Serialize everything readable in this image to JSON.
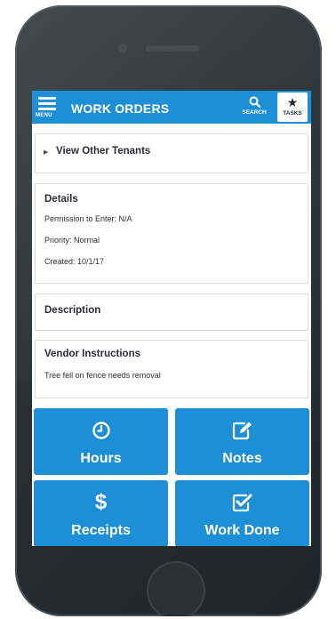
{
  "header": {
    "menu_label": "MENU",
    "title": "WORK ORDERS",
    "search_label": "SEARCH",
    "tasks_label": "TASKS"
  },
  "tenants": {
    "label": "View Other Tenants"
  },
  "details": {
    "title": "Details",
    "permission": "Permission to Enter: N/A",
    "priority": "Priority: Normal",
    "created": "Created: 10/1/17"
  },
  "description": {
    "title": "Description"
  },
  "vendor": {
    "title": "Vendor Instructions",
    "text": "Tree fell on fence needs removal"
  },
  "tiles": {
    "hours": "Hours",
    "notes": "Notes",
    "receipts": "Receipts",
    "work_done": "Work Done",
    "dollar_symbol": "$"
  },
  "icons": {
    "menu": "hamburger-icon",
    "search": "search-icon",
    "tasks": "star-icon",
    "hours": "clock-icon",
    "notes": "edit-icon",
    "receipts": "dollar-icon",
    "work_done": "checkbox-icon"
  },
  "colors": {
    "accent": "#1c8fd6",
    "phone_body": "#2a2f33"
  }
}
